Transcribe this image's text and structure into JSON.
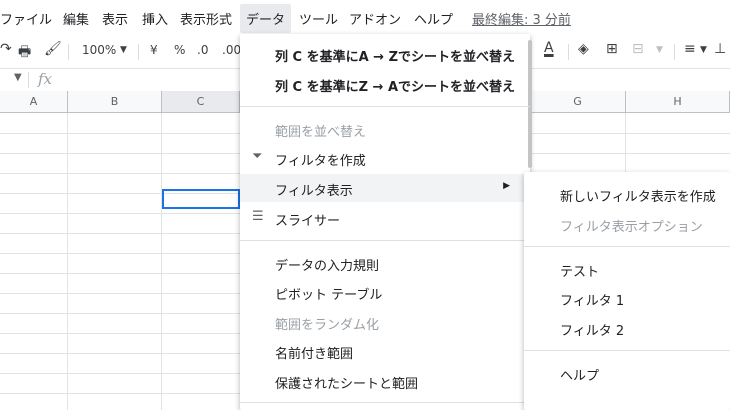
{
  "menubar": {
    "items": [
      "ファイル",
      "編集",
      "表示",
      "挿入",
      "表示形式",
      "データ",
      "ツール",
      "アドオン",
      "ヘルプ"
    ],
    "active": "データ",
    "last_edit": "最終編集: 3 分前"
  },
  "toolbar": {
    "zoom": "100%",
    "currency": "¥",
    "percent": "%",
    "decimal_decrease": ".0",
    "decimal_increase": ".00",
    "text_color_glyph": "A"
  },
  "formula_bar": {
    "fx": "fx"
  },
  "grid": {
    "columns": [
      "A",
      "B",
      "C",
      "",
      "",
      "G",
      "H"
    ],
    "selected_column": "C",
    "selected_cell": "C6"
  },
  "data_menu": {
    "items": [
      {
        "label": "列 C を基準にA → Zでシートを並べ替え",
        "bold": true
      },
      {
        "label": "列 C を基準にZ → Aでシートを並べ替え",
        "bold": true
      },
      {
        "label": "範囲を並べ替え",
        "disabled": true
      },
      {
        "label": "フィルタを作成",
        "icon": "filter-icon"
      },
      {
        "label": "フィルタ表示",
        "submenu": true,
        "highlighted": true
      },
      {
        "label": "スライサー",
        "icon": "slicer-icon"
      },
      {
        "label": "データの入力規則"
      },
      {
        "label": "ピボット テーブル"
      },
      {
        "label": "範囲をランダム化",
        "disabled": true
      },
      {
        "label": "名前付き範囲"
      },
      {
        "label": "保護されたシートと範囲"
      }
    ]
  },
  "filter_view_submenu": {
    "items": [
      {
        "label": "新しいフィルタ表示を作成"
      },
      {
        "label": "フィルタ表示オプション",
        "disabled": true
      },
      {
        "label": "テスト"
      },
      {
        "label": "フィルタ 1"
      },
      {
        "label": "フィルタ 2"
      },
      {
        "label": "ヘルプ"
      }
    ]
  }
}
